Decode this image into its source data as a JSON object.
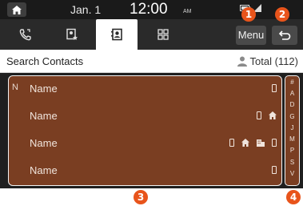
{
  "status_bar": {
    "date": "Jan. 1",
    "time": "12:00",
    "ampm": "AM"
  },
  "tabs": [
    {
      "icon": "recent-calls-icon",
      "active": false
    },
    {
      "icon": "favorites-icon",
      "active": false
    },
    {
      "icon": "contacts-icon",
      "active": true
    },
    {
      "icon": "dialpad-icon",
      "active": false
    }
  ],
  "header": {
    "menu_label": "Menu",
    "back_icon": "back-arrow-icon"
  },
  "search": {
    "label": "Search Contacts",
    "total_label": "Total (112)"
  },
  "contacts": {
    "group_initial": "N",
    "rows": [
      {
        "name": "Name",
        "icons": [
          "mobile-phone-icon"
        ]
      },
      {
        "name": "Name",
        "icons": [
          "mobile-phone-icon",
          "home-icon"
        ]
      },
      {
        "name": "Name",
        "icons": [
          "mobile-phone-icon",
          "home-icon",
          "office-icon",
          "phone-icon"
        ]
      },
      {
        "name": "Name",
        "icons": [
          "mobile-phone-icon"
        ]
      }
    ]
  },
  "alpha_index": [
    "#",
    "A",
    "D",
    "G",
    "J",
    "M",
    "P",
    "S",
    "V"
  ],
  "callouts": [
    "1",
    "2",
    "3",
    "4"
  ],
  "colors": {
    "list_background": "#7a3e22",
    "callout": "#e8541b",
    "screen_background": "#1c1c1c"
  }
}
